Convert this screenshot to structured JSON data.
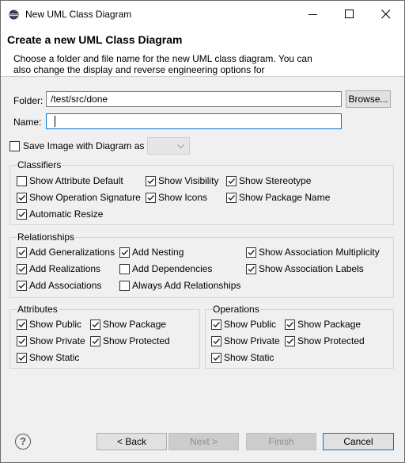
{
  "window": {
    "title": "New UML Class Diagram"
  },
  "header": {
    "title": "Create a new UML Class Diagram",
    "description": "Choose a folder and file name for the new UML class diagram. You can also change the display and reverse engineering options for"
  },
  "form": {
    "folder_label": "Folder:",
    "folder_value": "/test/src/done",
    "browse_label": "Browse...",
    "name_label": "Name:",
    "name_value": "",
    "save_image_label": "Save Image with Diagram as",
    "save_image_checked": false,
    "save_image_format": ""
  },
  "classifiers": {
    "title": "Classifiers",
    "options": [
      {
        "label": "Show Attribute Default",
        "checked": false
      },
      {
        "label": "Show Visibility",
        "checked": true
      },
      {
        "label": "Show Stereotype",
        "checked": true
      },
      {
        "label": "Show Operation Signature",
        "checked": true
      },
      {
        "label": "Show Icons",
        "checked": true
      },
      {
        "label": "Show Package Name",
        "checked": true
      },
      {
        "label": "Automatic Resize",
        "checked": true
      }
    ]
  },
  "relationships": {
    "title": "Relationships",
    "options": [
      {
        "label": "Add Generalizations",
        "checked": true
      },
      {
        "label": "Add Nesting",
        "checked": true
      },
      {
        "label": "Show Association Multiplicity",
        "checked": true
      },
      {
        "label": "Add Realizations",
        "checked": true
      },
      {
        "label": "Add Dependencies",
        "checked": false
      },
      {
        "label": "Show Association Labels",
        "checked": true
      },
      {
        "label": "Add Associations",
        "checked": true
      },
      {
        "label": "Always Add Relationships",
        "checked": false
      }
    ]
  },
  "attributes": {
    "title": "Attributes",
    "options": [
      {
        "label": "Show Public",
        "checked": true
      },
      {
        "label": "Show Package",
        "checked": true
      },
      {
        "label": "Show Private",
        "checked": true
      },
      {
        "label": "Show Protected",
        "checked": true
      },
      {
        "label": "Show Static",
        "checked": true
      }
    ]
  },
  "operations": {
    "title": "Operations",
    "options": [
      {
        "label": "Show Public",
        "checked": true
      },
      {
        "label": "Show Package",
        "checked": true
      },
      {
        "label": "Show Private",
        "checked": true
      },
      {
        "label": "Show Protected",
        "checked": true
      },
      {
        "label": "Show Static",
        "checked": true
      }
    ]
  },
  "footer": {
    "help_glyph": "?",
    "back_label": "< Back",
    "next_label": "Next >",
    "finish_label": "Finish",
    "cancel_label": "Cancel",
    "next_enabled": false,
    "finish_enabled": false
  },
  "icons": {
    "app": "eclipse-icon",
    "minimize": "minimize-icon",
    "maximize": "maximize-icon",
    "close": "close-icon",
    "dropdown": "chevron-down-icon",
    "help": "help-icon"
  },
  "colors": {
    "accent": "#0078d7",
    "dialog_bg": "#f0f0f0",
    "header_bg": "#ffffff",
    "eclipse_purple": "#2c2255"
  }
}
